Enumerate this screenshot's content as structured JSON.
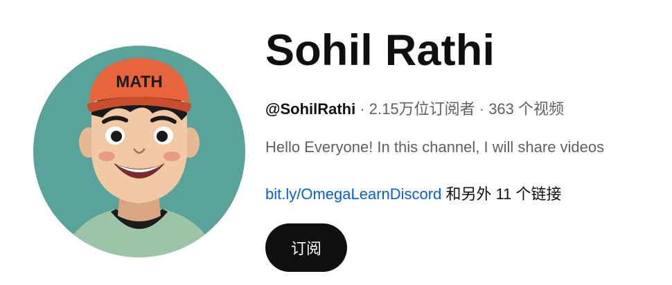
{
  "channel": {
    "name": "Sohil Rathi",
    "handle": "@SohilRathi",
    "separator": " · ",
    "subscribers": "2.15万位订阅者",
    "videos": "363 个视频",
    "description": "Hello Everyone! In this channel, I will share videos",
    "link_text": "bit.ly/OmegaLearnDiscord",
    "more_links": " 和另外 11 个链接",
    "subscribe_label": "订阅",
    "avatar_cap_text": "MATH"
  },
  "colors": {
    "link": "#065fd4",
    "subscribe_bg": "#0f0f0f",
    "avatar_bg": "#5aa39a",
    "cap": "#e8643c"
  }
}
